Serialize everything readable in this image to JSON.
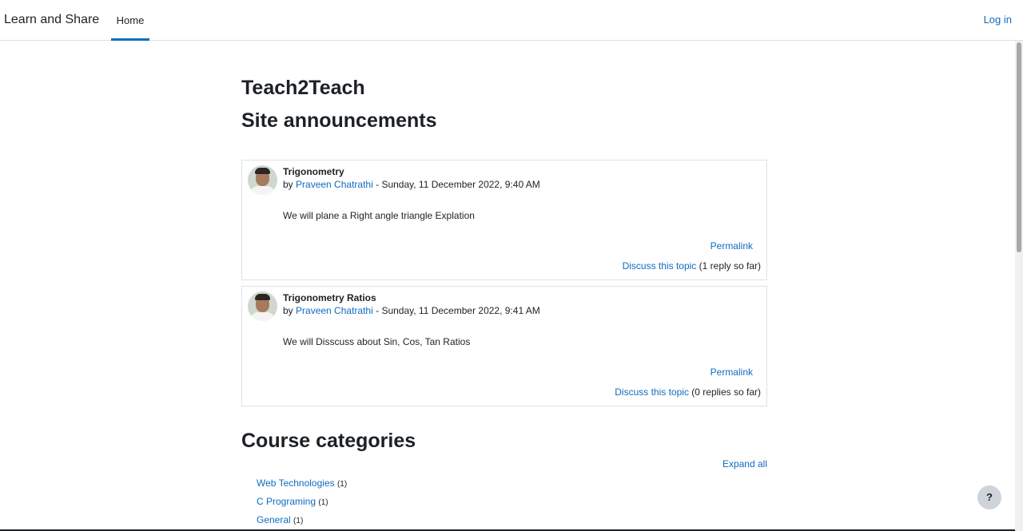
{
  "navbar": {
    "brand": "Learn and Share",
    "home_label": "Home",
    "login_label": "Log in"
  },
  "main": {
    "site_title": "Teach2Teach",
    "announcements_title": "Site announcements",
    "posts": [
      {
        "title": "Trigonometry",
        "by": "by",
        "author": "Praveen Chatrathi",
        "date": "- Sunday, 11 December 2022, 9:40 AM",
        "body": "We will plane a Right angle triangle Explation",
        "permalink": "Permalink",
        "discuss": "Discuss this topic",
        "replies": "(1 reply so far)"
      },
      {
        "title": "Trigonometry Ratios",
        "by": "by",
        "author": "Praveen Chatrathi",
        "date": "- Sunday, 11 December 2022, 9:41 AM",
        "body": "We will Disscuss about Sin, Cos, Tan Ratios",
        "permalink": "Permalink",
        "discuss": "Discuss this topic",
        "replies": "(0 replies so far)"
      }
    ],
    "categories_title": "Course categories",
    "expand_all": "Expand all",
    "categories": [
      {
        "name": "Web Technologies",
        "count": "(1)"
      },
      {
        "name": "C Programing",
        "count": "(1)"
      },
      {
        "name": "General",
        "count": "(1)"
      }
    ]
  },
  "help": {
    "label": "?"
  },
  "colors": {
    "link": "#0f6cbf",
    "text": "#1d2125",
    "border": "#dee2e6"
  }
}
